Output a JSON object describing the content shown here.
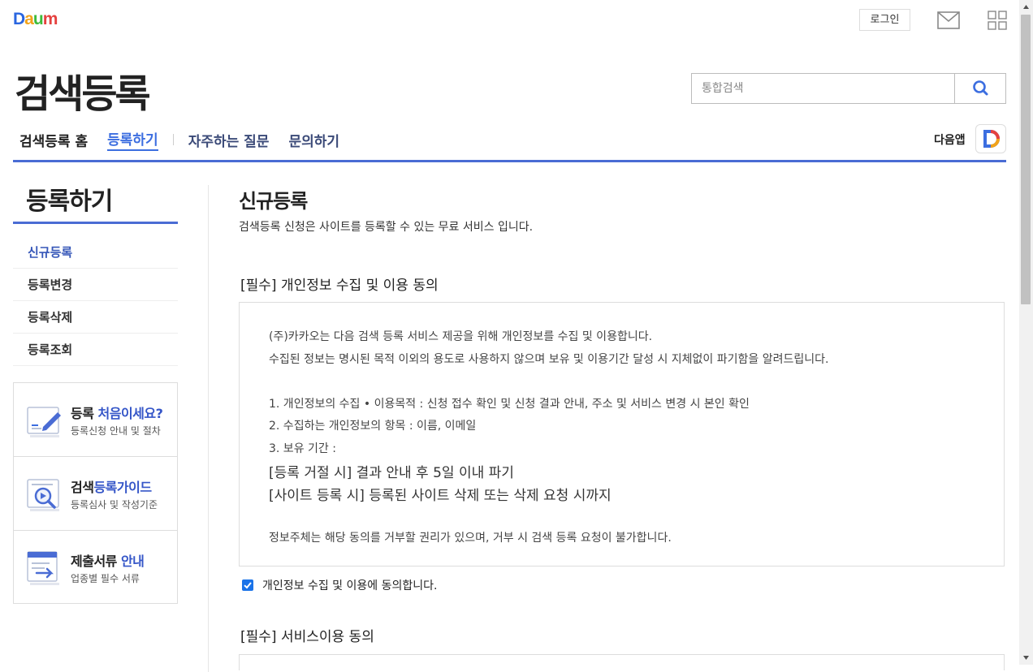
{
  "header": {
    "logo_letters": [
      {
        "ch": "D",
        "color": "#2a66e0"
      },
      {
        "ch": "a",
        "color": "#f2a31a"
      },
      {
        "ch": "u",
        "color": "#3dbb3a"
      },
      {
        "ch": "m",
        "color": "#e5413f"
      }
    ],
    "login_label": "로그인",
    "mail_icon": "mail-icon",
    "apps_icon": "grid-apps-icon"
  },
  "page": {
    "title": "검색등록"
  },
  "search": {
    "placeholder": "통합검색",
    "value": ""
  },
  "nav": {
    "items": [
      {
        "label": "검색등록 홈"
      },
      {
        "label": "등록하기"
      },
      {
        "label": "자주하는 질문"
      },
      {
        "label": "문의하기"
      }
    ],
    "active_index": 1,
    "app_label": "다음앱"
  },
  "sidebar": {
    "title": "등록하기",
    "items": [
      {
        "label": "신규등록"
      },
      {
        "label": "등록변경"
      },
      {
        "label": "등록삭제"
      },
      {
        "label": "등록조회"
      }
    ],
    "banners": [
      {
        "title_plain": "등록 ",
        "title_highlight": "처음이세요?",
        "subtitle": "등록신청 안내 및 절차"
      },
      {
        "title_plain": "검색",
        "title_highlight": "등록가이드",
        "subtitle": "등록심사 및 작성기준"
      },
      {
        "title_plain": "제출서류 ",
        "title_highlight": "안내",
        "subtitle": "업종별 필수 서류"
      }
    ]
  },
  "content": {
    "title": "신규등록",
    "description": "검색등록 신청은 사이트를 등록할 수 있는 무료 서비스 입니다.",
    "section1_title": "[필수] 개인정보 수집 및 이용 동의",
    "agreement_lines": [
      "(주)카카오는 다음 검색 등록 서비스 제공을 위해 개인정보를 수집 및 이용합니다.",
      "수집된 정보는 명시된 목적 이외의 용도로 사용하지 않으며 보유 및 이용기간 달성 시 지체없이 파기함을 알려드립니다.",
      "1. 개인정보의 수집 • 이용목적 : 신청 접수 확인 및 신청 결과 안내, 주소 및 서비스 변경 시 본인 확인",
      "2. 수집하는 개인정보의 항목 : 이름, 이메일",
      "3. 보유 기간 :",
      "[등록 거절 시] 결과 안내 후 5일 이내 파기",
      "[사이트 등록 시] 등록된 사이트 삭제 또는 삭제 요청 시까지",
      "정보주체는 해당 동의를 거부할 권리가 있으며, 거부 시 검색 등록 요청이 불가합니다."
    ],
    "consent_checkbox_label": "개인정보 수집 및 이용에 동의합니다.",
    "consent_checked": true,
    "section2_title": "[필수] 서비스이용 동의"
  },
  "colors": {
    "accent": "#4a6cd4",
    "active_nav": "#3c6ee0",
    "checkbox": "#1a73e8"
  }
}
